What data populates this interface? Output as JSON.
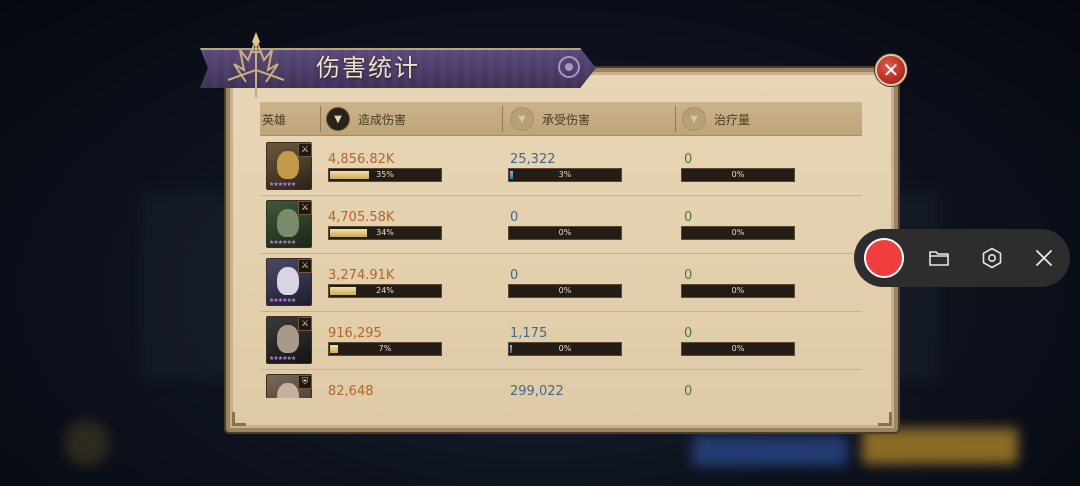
{
  "panel": {
    "title": "伤害统计"
  },
  "headers": {
    "hero": "英雄",
    "damage_dealt": "造成伤害",
    "damage_taken": "承受伤害",
    "healing": "治疗量"
  },
  "rows": [
    {
      "dealt": "4,856.82K",
      "dealt_pct": "35%",
      "dealt_frac": 0.35,
      "taken": "25,322",
      "taken_pct": "3%",
      "taken_frac": 0.03,
      "heal": "0",
      "heal_pct": "0%",
      "heal_frac": 0
    },
    {
      "dealt": "4,705.58K",
      "dealt_pct": "34%",
      "dealt_frac": 0.34,
      "taken": "0",
      "taken_pct": "0%",
      "taken_frac": 0,
      "heal": "0",
      "heal_pct": "0%",
      "heal_frac": 0
    },
    {
      "dealt": "3,274.91K",
      "dealt_pct": "24%",
      "dealt_frac": 0.24,
      "taken": "0",
      "taken_pct": "0%",
      "taken_frac": 0,
      "heal": "0",
      "heal_pct": "0%",
      "heal_frac": 0
    },
    {
      "dealt": "916,295",
      "dealt_pct": "7%",
      "dealt_frac": 0.07,
      "taken": "1,175",
      "taken_pct": "0%",
      "taken_frac": 0.004,
      "heal": "0",
      "heal_pct": "0%",
      "heal_frac": 0
    },
    {
      "dealt": "82,648",
      "taken": "299,022",
      "heal": "0"
    }
  ],
  "colors": {
    "damage_text": "#b4652a",
    "taken_text": "#3f6a8a",
    "heal_text": "#4d7a2a",
    "record_button": "#f03e3e"
  },
  "icons": {
    "close": "close-icon",
    "sort": "sort-down-icon",
    "folder": "folder-icon",
    "settings": "hexagon-settings-icon",
    "exit": "close-x-icon"
  }
}
